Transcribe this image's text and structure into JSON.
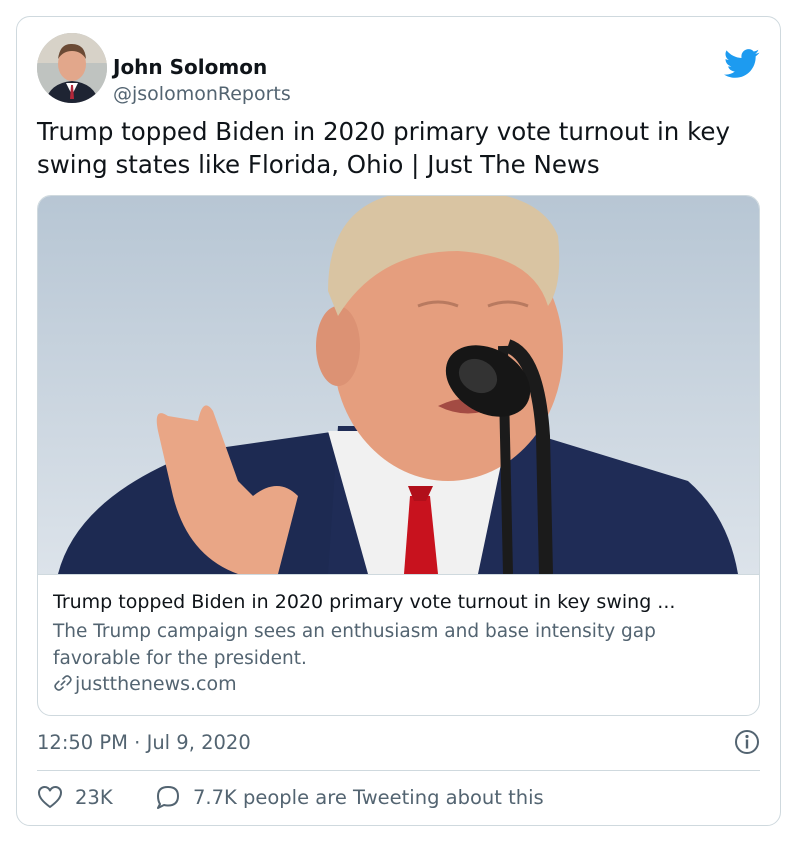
{
  "author": {
    "display_name": "John Solomon",
    "handle": "@jsolomonReports"
  },
  "tweet": {
    "text": "Trump topped Biden in 2020 primary vote turnout in key swing states like Florida, Ohio | Just The News",
    "timestamp": "12:50 PM · Jul 9, 2020"
  },
  "card": {
    "title": "Trump topped Biden in 2020 primary vote turnout in key swing ...",
    "description": "The Trump campaign sees an enthusiasm and base intensity gap favorable for the president.",
    "domain": "justthenews.com"
  },
  "actions": {
    "likes": "23K",
    "conversation": "7.7K people are Tweeting about this"
  },
  "icons": {
    "brand": "twitter-bird-icon",
    "info": "info-icon",
    "like": "heart-icon",
    "reply": "speech-bubble-icon",
    "link": "link-icon"
  },
  "colors": {
    "brand_blue": "#1d9bf0",
    "text_primary": "#0f1419",
    "text_secondary": "#536471",
    "border": "#cfd9de"
  }
}
